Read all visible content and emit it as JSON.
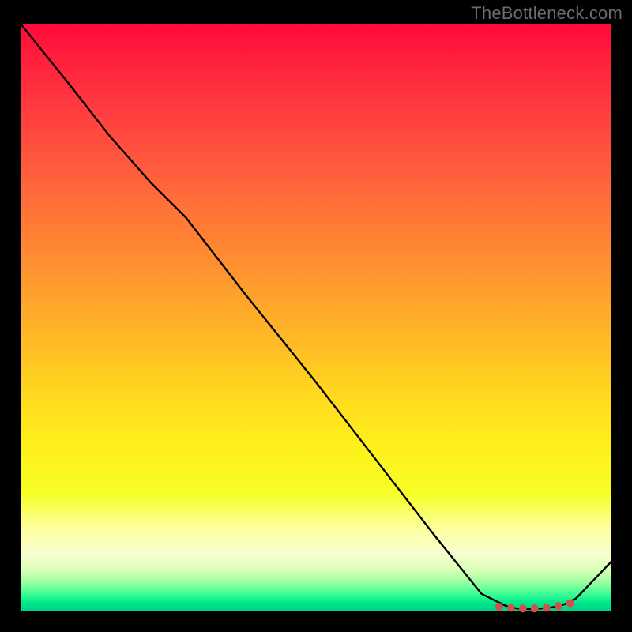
{
  "watermark": "TheBottleneck.com",
  "chart_data": {
    "type": "line",
    "title": "",
    "xlabel": "",
    "ylabel": "",
    "xlim": [
      0,
      100
    ],
    "ylim": [
      0,
      100
    ],
    "grid": false,
    "legend": false,
    "annotations": [],
    "series": [
      {
        "name": "curve",
        "x": [
          0,
          8,
          15,
          22,
          28,
          38,
          50,
          60,
          70,
          78,
          82,
          84,
          86,
          88,
          90,
          92,
          94,
          100
        ],
        "values": [
          100,
          90,
          81,
          73,
          67,
          54,
          39,
          26,
          13,
          3,
          1,
          0.5,
          0.4,
          0.5,
          0.7,
          1.2,
          2.2,
          8.5
        ]
      }
    ],
    "markers": {
      "comment": "flat cluster near minimum",
      "x": [
        81,
        83,
        85,
        87,
        89,
        91,
        93
      ],
      "values": [
        0.8,
        0.6,
        0.5,
        0.5,
        0.6,
        0.9,
        1.4
      ]
    }
  },
  "colors": {
    "background": "#000000",
    "curve": "#000000",
    "marker": "#CE524A",
    "watermark": "#6c6c6c"
  }
}
